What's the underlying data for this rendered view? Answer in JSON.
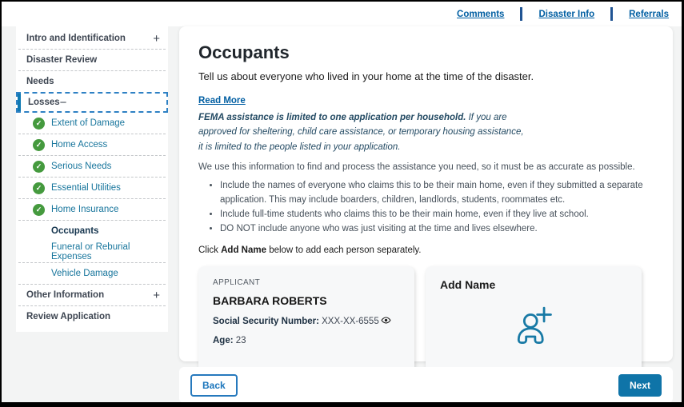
{
  "header": {
    "links": [
      {
        "label": "Comments"
      },
      {
        "label": "Disaster Info"
      },
      {
        "label": "Referrals"
      }
    ]
  },
  "icons": {
    "plus": "+",
    "minus": "−",
    "check": "✓"
  },
  "sidebar": {
    "sections": [
      {
        "label": "Intro and Identification",
        "expander": "plus"
      },
      {
        "label": "Disaster Review"
      },
      {
        "label": "Needs"
      },
      {
        "label": "Losses",
        "expander": "minus",
        "active": true
      },
      {
        "label": "Other Information",
        "expander": "plus"
      },
      {
        "label": "Review Application"
      }
    ],
    "losses_children": [
      {
        "label": "Extent of Damage",
        "complete": true
      },
      {
        "label": "Home Access",
        "complete": true
      },
      {
        "label": "Serious Needs",
        "complete": true
      },
      {
        "label": "Essential Utilities",
        "complete": true
      },
      {
        "label": "Home Insurance",
        "complete": true
      },
      {
        "label": "Occupants",
        "current": true
      },
      {
        "label": "Funeral or Reburial Expenses"
      },
      {
        "label": "Vehicle Damage"
      }
    ]
  },
  "main": {
    "title": "Occupants",
    "subtitle": "Tell us about everyone who lived in your home at the time of the disaster.",
    "read_more": "Read More",
    "fema_bold": "FEMA assistance is limited to one application per household.",
    "fema_line1_rest": " If you are",
    "fema_line2": "approved for sheltering, child care assistance, or temporary housing assistance,",
    "fema_line3": "it is limited to the people listed in your application.",
    "info": "We use this information to find and process the assistance you need, so it must be as accurate as possible.",
    "bullets": [
      "Include the names of everyone who claims this to be their main home, even if they submitted a separate application. This may include boarders, children, landlords, students, roommates etc.",
      "Include full-time students who claims this to be their main home, even if they live at school.",
      "DO NOT include anyone who was just visiting at the time and lives elsewhere."
    ],
    "click_prefix": "Click ",
    "click_bold": "Add Name",
    "click_suffix": " below to add each person separately.",
    "applicant_card": {
      "role_label": "APPLICANT",
      "name": "BARBARA ROBERTS",
      "ssn_label": "Social Security Number:",
      "ssn_value": " XXX-XX-6555",
      "age_label": "Age:",
      "age_value": " 23"
    },
    "add_card": {
      "label": "Add Name"
    }
  },
  "footer": {
    "back_label": "Back",
    "next_label": "Next"
  },
  "colors": {
    "link_blue": "#005ea2",
    "sidebar_link_blue": "#17759c",
    "active_dashed_border": "#2e81c4",
    "active_left_bar": "#0e79b2",
    "success_green": "#459a3e",
    "primary_button": "#0f74a8",
    "divider_navy": "#205493",
    "page_background": "#f3f4f4",
    "card_background": "#f7f8f9"
  }
}
